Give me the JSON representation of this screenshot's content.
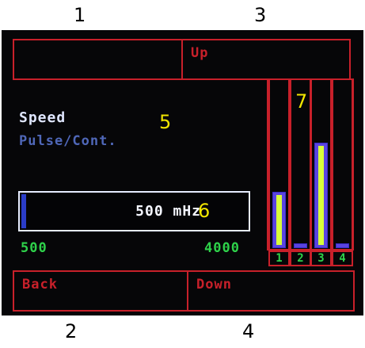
{
  "outer_labels": [
    "1",
    "2",
    "3",
    "4"
  ],
  "softkeys": {
    "key1": "",
    "key2": "Back",
    "key3": "Up",
    "key4": "Down"
  },
  "parameter": {
    "name": "Speed",
    "mode": "Pulse/Cont.",
    "value_text": "500 mHz",
    "value": 500,
    "range_min": "500",
    "range_max": "4000"
  },
  "annotations": [
    "5",
    "6",
    "7"
  ],
  "bars": [
    {
      "label": "1",
      "level": 0.34
    },
    {
      "label": "2",
      "level": 0.03
    },
    {
      "label": "3",
      "level": 0.64
    },
    {
      "label": "4",
      "level": 0.03
    }
  ],
  "colors": {
    "frame_red": "#c8202a",
    "bar_purple": "#5a44e0",
    "bar_yellow": "#d8ff3a",
    "range_green": "#2ed24a",
    "mode_blue": "#4f67b8",
    "annotation_yellow": "#f2e600"
  }
}
